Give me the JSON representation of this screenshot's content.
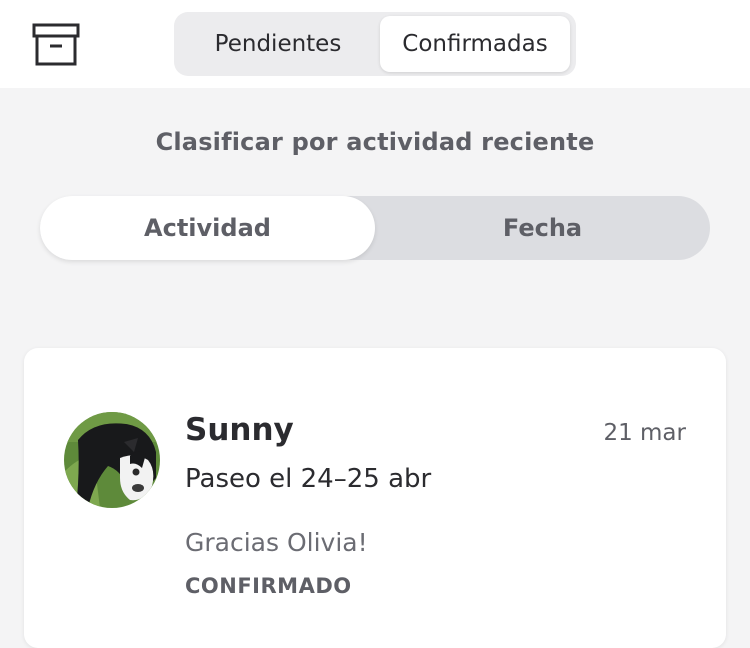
{
  "header": {
    "archive_icon": "archive-box-icon",
    "tabs": [
      {
        "label": "Pendientes",
        "selected": false
      },
      {
        "label": "Confirmadas",
        "selected": true
      }
    ]
  },
  "sort": {
    "label": "Clasificar por actividad reciente",
    "options": [
      {
        "label": "Actividad",
        "selected": true
      },
      {
        "label": "Fecha",
        "selected": false
      }
    ]
  },
  "cards": [
    {
      "pet_name": "Sunny",
      "date": "21 mar",
      "service": "Paseo el 24–25 abr",
      "message": "Gracias Olivia!",
      "status": "CONFIRMADO"
    }
  ],
  "colors": {
    "background": "#f4f4f5",
    "text_primary": "#2b2b2f",
    "text_secondary": "#5e5f66",
    "toggle_track": "#dcdde1"
  }
}
